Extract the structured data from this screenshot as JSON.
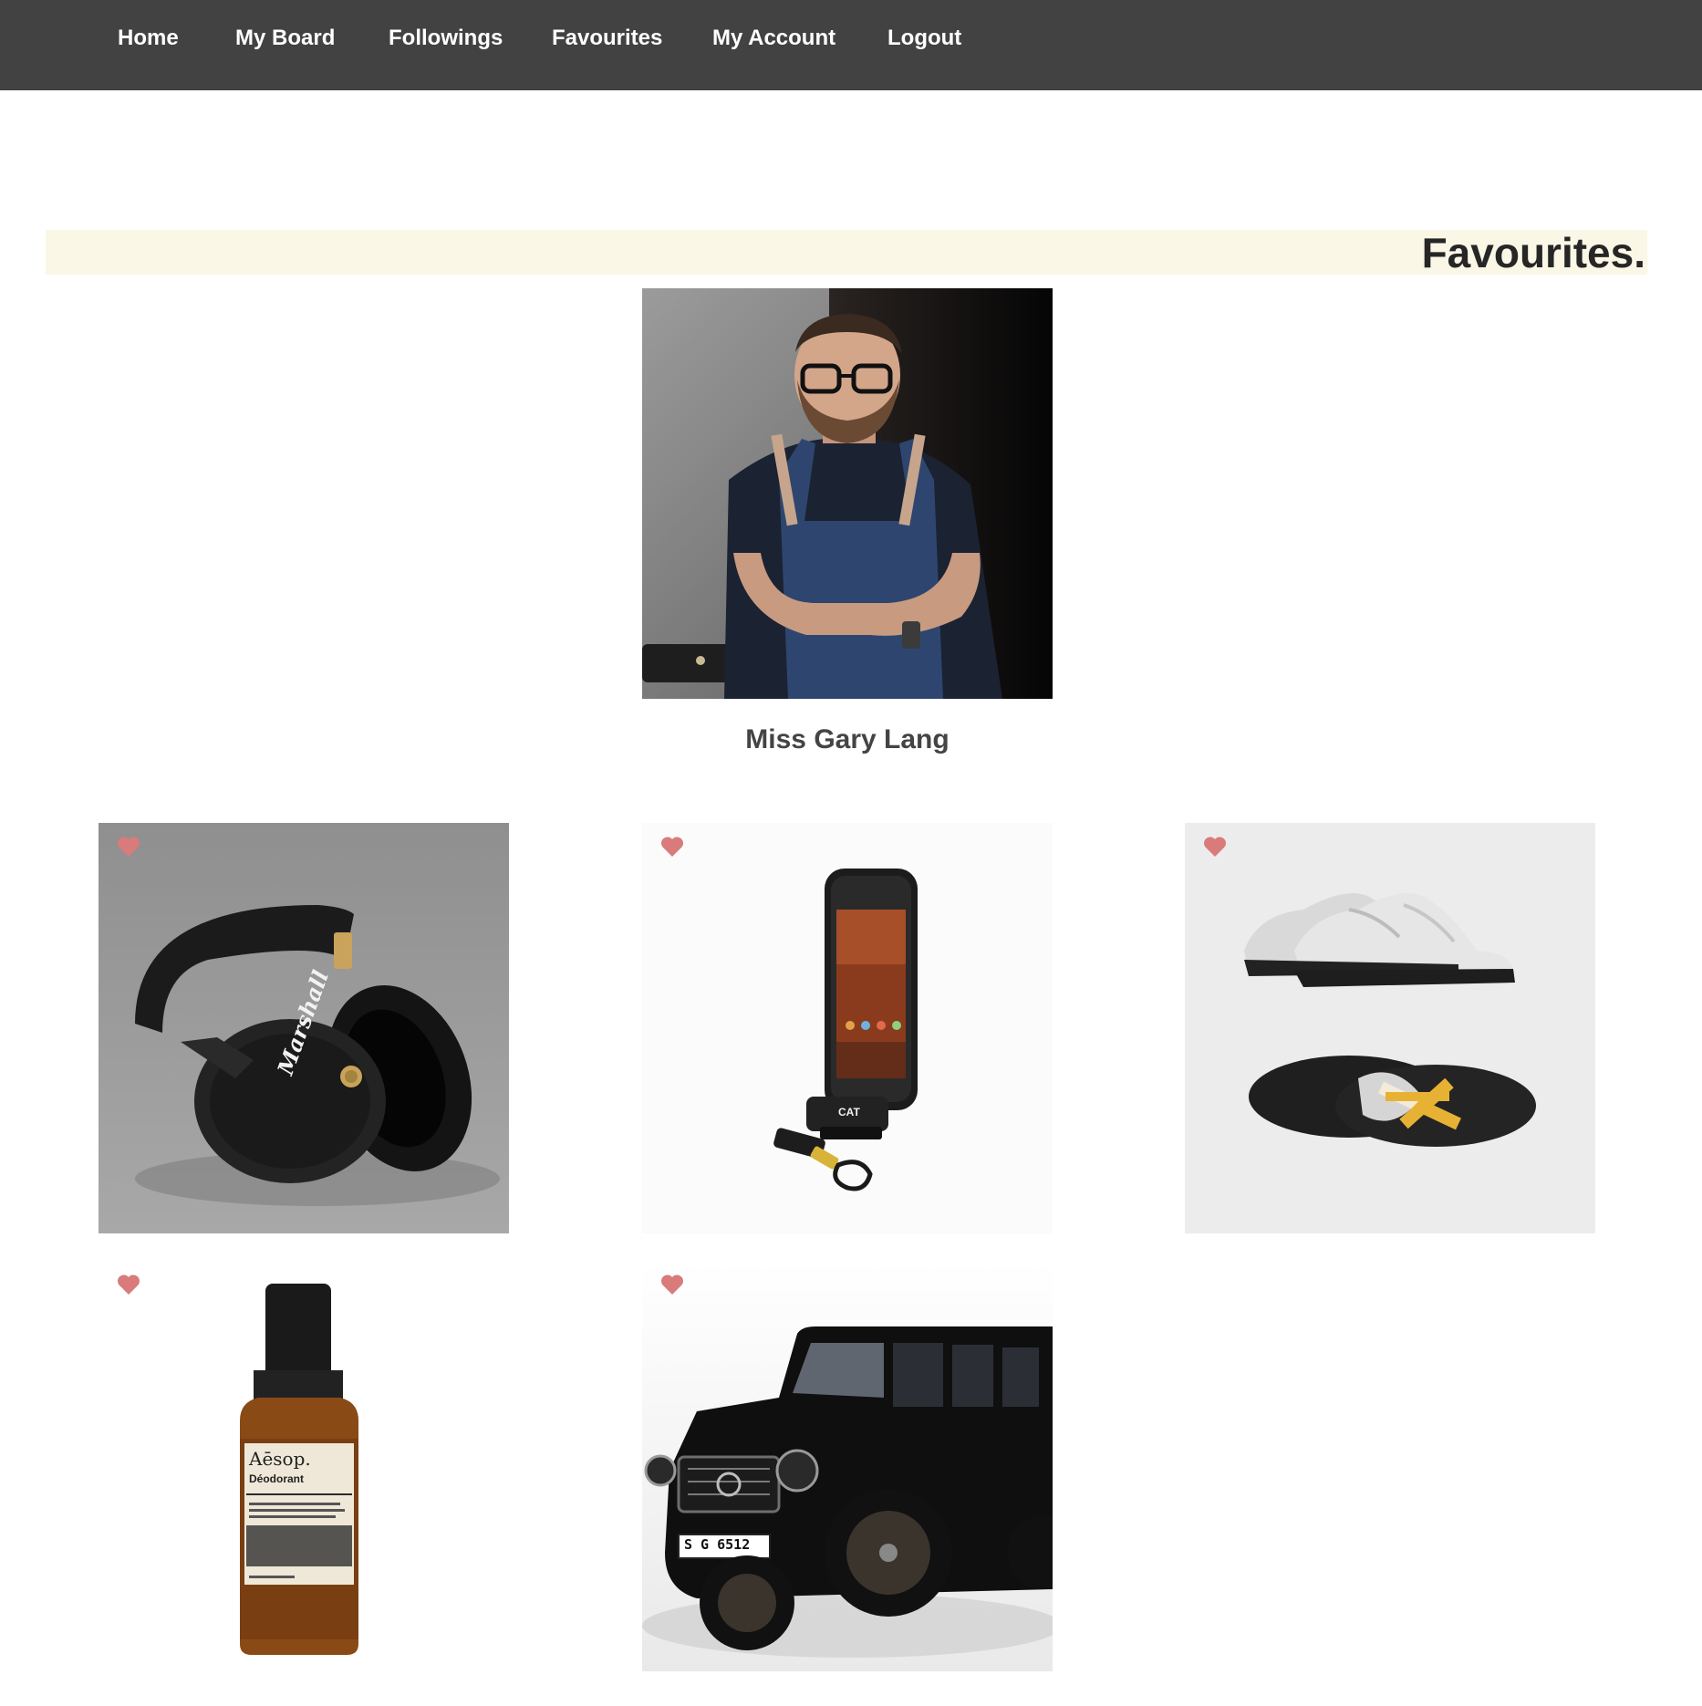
{
  "nav": {
    "items": [
      {
        "label": "Home"
      },
      {
        "label": "My Board"
      },
      {
        "label": "Followings"
      },
      {
        "label": "Favourites"
      },
      {
        "label": "My Account"
      },
      {
        "label": "Logout"
      }
    ]
  },
  "page": {
    "title": "Favourites."
  },
  "profile": {
    "name": "Miss Gary Lang"
  },
  "favourites": {
    "items": [
      {
        "name": "Headphones",
        "icon": "headphones-image",
        "brand_text": "Marshall"
      },
      {
        "name": "Rugged phone",
        "icon": "phone-image",
        "brand_text": "CAT"
      },
      {
        "name": "Sneakers",
        "icon": "sneakers-image"
      },
      {
        "name": "Deodorant",
        "icon": "deodorant-image",
        "brand_text": "Aēsop.",
        "sub_text": "Déodorant"
      },
      {
        "name": "SUV",
        "icon": "suv-image",
        "plate_text": "S G 6512"
      }
    ],
    "heart_color": "#d97b7b"
  },
  "colors": {
    "nav_bg": "#434243",
    "banner_bg": "#faf7e6"
  }
}
